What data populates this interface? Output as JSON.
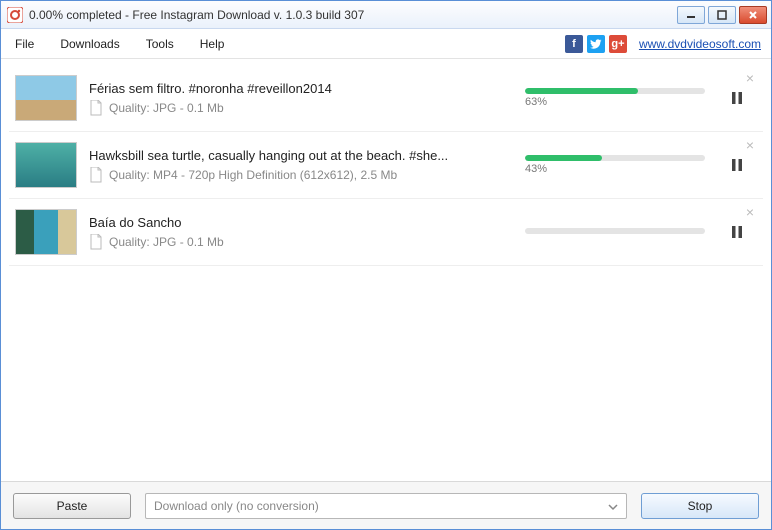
{
  "window": {
    "title": "0.00% completed - Free Instagram Download  v. 1.0.3 build 307"
  },
  "menu": {
    "file": "File",
    "downloads": "Downloads",
    "tools": "Tools",
    "help": "Help"
  },
  "social": {
    "fb": "f",
    "tw": "t",
    "gp": "g+"
  },
  "site_link": "www.dvdvideosoft.com",
  "downloads": [
    {
      "title": "Férias sem filtro. #noronha #reveillon2014",
      "quality": "Quality: JPG - 0.1 Mb",
      "percent": 63,
      "percent_label": "63%"
    },
    {
      "title": "Hawksbill sea turtle, casually hanging out at the beach. #she...",
      "quality": "Quality: MP4 - 720p High Definition (612x612), 2.5 Mb",
      "percent": 43,
      "percent_label": "43%"
    },
    {
      "title": "Baía do Sancho",
      "quality": "Quality: JPG - 0.1 Mb",
      "percent": 0,
      "percent_label": ""
    }
  ],
  "bottom": {
    "paste": "Paste",
    "dropdown": "Download only (no conversion)",
    "stop": "Stop"
  }
}
